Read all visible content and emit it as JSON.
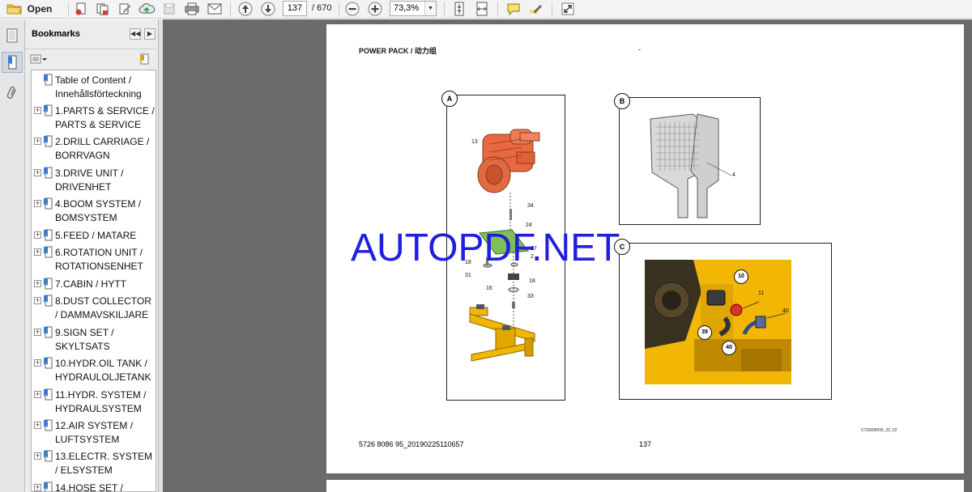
{
  "toolbar": {
    "open_label": "Open",
    "page_current": "137",
    "page_total": "/ 670",
    "zoom": "73,3%"
  },
  "bookmarks": {
    "title": "Bookmarks",
    "items": [
      {
        "label": "Table of Content / Innehållsförteckning",
        "expandable": false
      },
      {
        "label": "1.PARTS & SERVICE / PARTS & SERVICE",
        "expandable": true
      },
      {
        "label": "2.DRILL CARRIAGE / BORRVAGN",
        "expandable": true
      },
      {
        "label": "3.DRIVE UNIT / DRIVENHET",
        "expandable": true
      },
      {
        "label": "4.BOOM SYSTEM / BOMSYSTEM",
        "expandable": true
      },
      {
        "label": "5.FEED / MATARE",
        "expandable": true
      },
      {
        "label": "6.ROTATION UNIT / ROTATIONSENHET",
        "expandable": true
      },
      {
        "label": "7.CABIN / HYTT",
        "expandable": true
      },
      {
        "label": "8.DUST COLLECTOR / DAMMAVSKILJARE",
        "expandable": true
      },
      {
        "label": "9.SIGN SET / SKYLTSATS",
        "expandable": true
      },
      {
        "label": "10.HYDR.OIL TANK / HYDRAULOLJETANK",
        "expandable": true
      },
      {
        "label": "11.HYDR. SYSTEM / HYDRAULSYSTEM",
        "expandable": true
      },
      {
        "label": "12.AIR SYSTEM / LUFTSYSTEM",
        "expandable": true
      },
      {
        "label": "13.ELECTR. SYSTEM / ELSYSTEM",
        "expandable": true
      },
      {
        "label": "14.HOSE SET /",
        "expandable": true
      }
    ]
  },
  "document": {
    "title": "POWER PACK / 动力组",
    "dash": "-",
    "callouts": {
      "a": "A",
      "b": "B",
      "c": "C"
    },
    "parts_a": {
      "p13": "13",
      "p34": "34",
      "p24": "24",
      "p27": "27",
      "p18a": "18",
      "p31": "31",
      "p16": "16",
      "p18b": "18",
      "p33": "33",
      "p3": "3",
      "p2": "2"
    },
    "parts_b": {
      "p4": "4"
    },
    "parts_c": {
      "p10": "10",
      "p11": "11",
      "p40a": "40",
      "p39": "39",
      "p40b": "40"
    },
    "footer_left": "5726 8086 95_20190225110657",
    "footer_page": "137",
    "drawing_ref": "5726808695_02_02",
    "watermark": "AUTOPDF.NET"
  },
  "colors": {
    "toolbar_bg": "#f3f3f3",
    "doc_bg": "#6b6b6b",
    "engine_orange": "#e8683f",
    "bracket_yellow": "#f2b705",
    "plate_green": "#7fbf5a",
    "watermark_blue": "#1f1fe0"
  }
}
